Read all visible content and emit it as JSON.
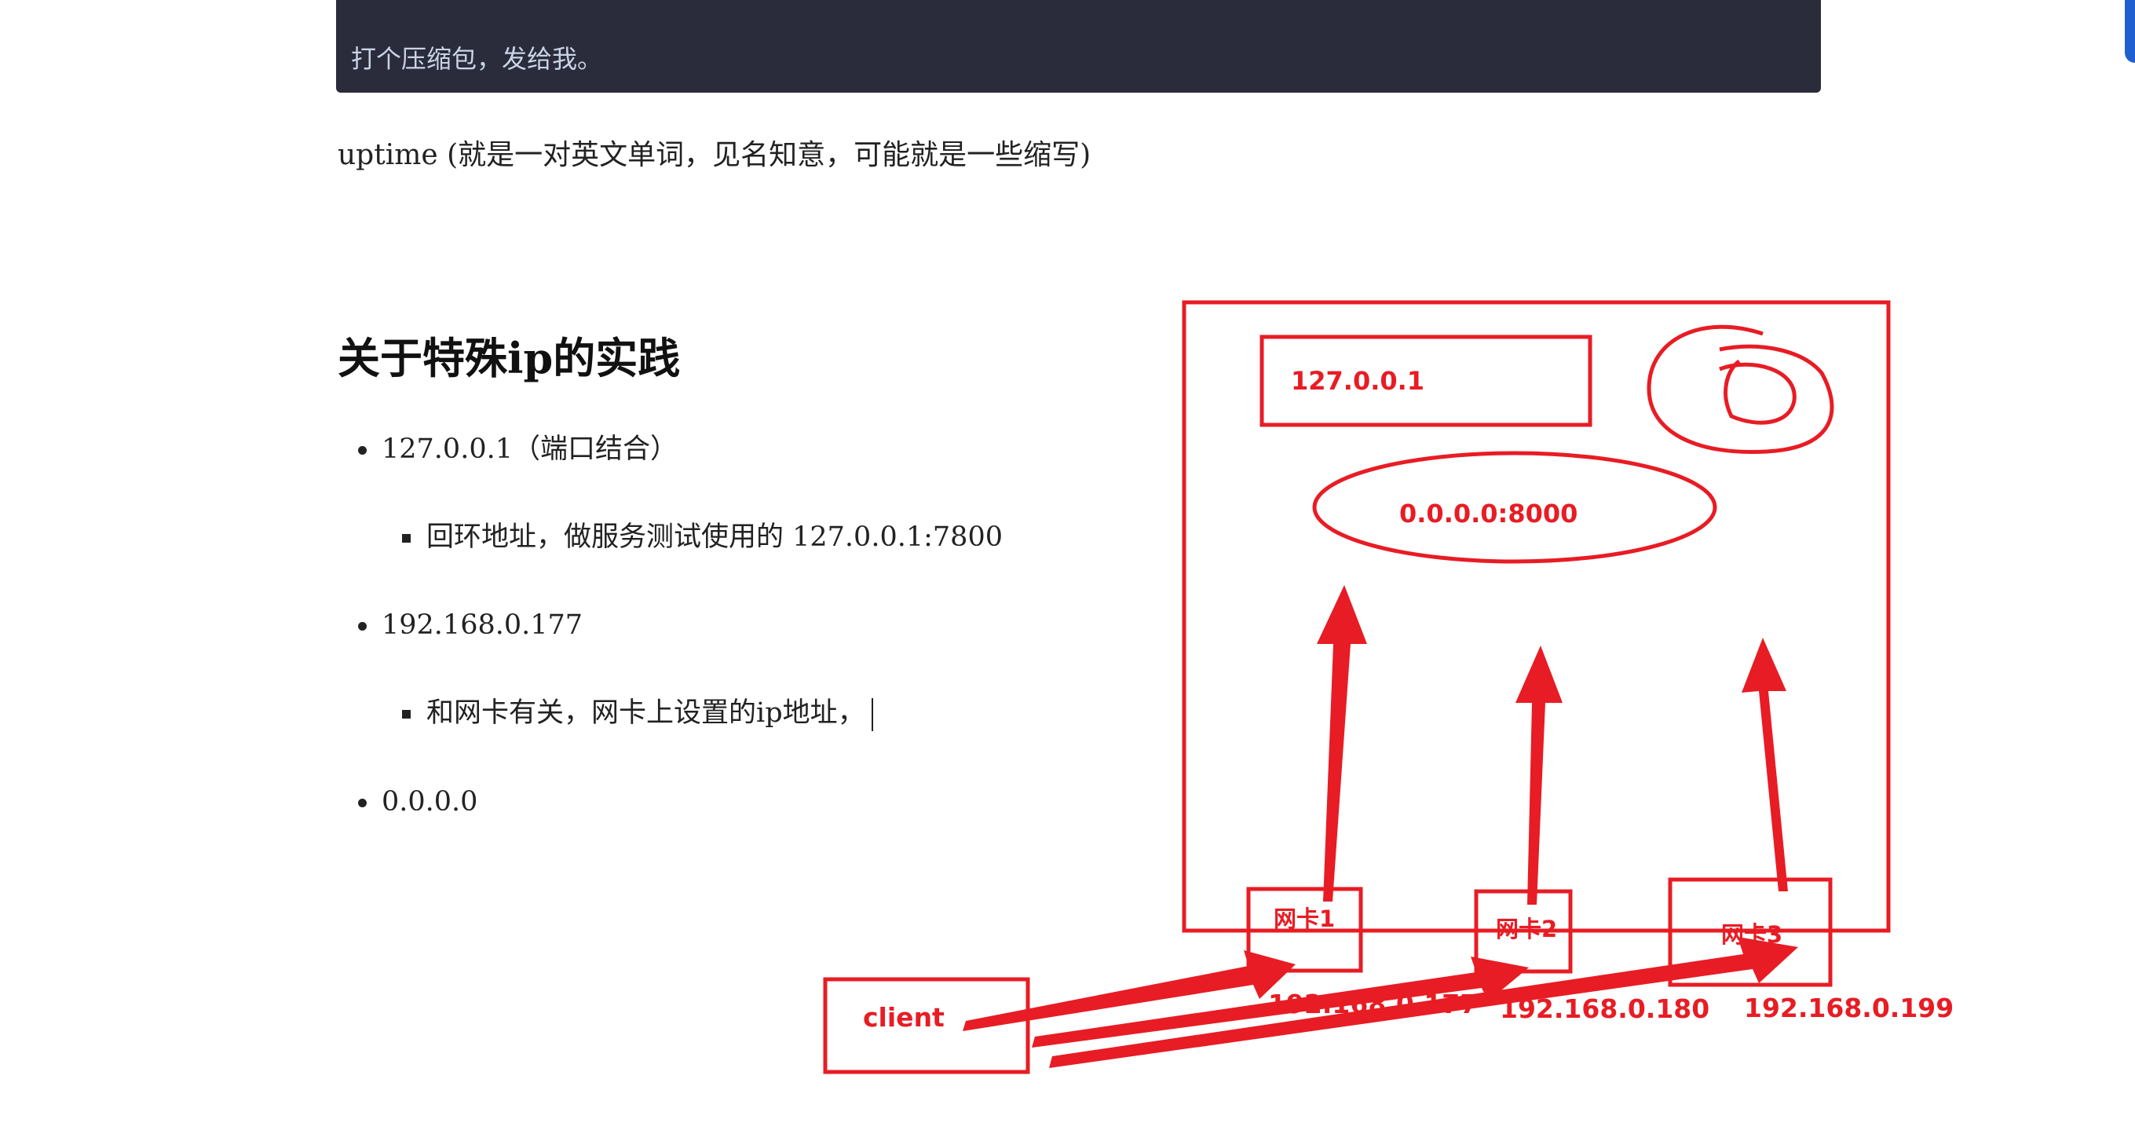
{
  "code_block": {
    "text": "打个压缩包，发给我。"
  },
  "paragraph": "uptime (就是一对英文单词，见名知意，可能就是一些缩写)",
  "heading": "关于特殊ip的实践",
  "list": [
    {
      "label": "127.0.0.1（端口结合）",
      "sub": "回环地址，做服务测试使用的 127.0.0.1:7800"
    },
    {
      "label": "192.168.0.177",
      "sub": "和网卡有关，网卡上设置的ip地址，"
    },
    {
      "label": "0.0.0.0"
    }
  ],
  "diagram": {
    "color": "#e81c24",
    "loopback_label": "127.0.0.1",
    "bind_label": "0.0.0.0:8000",
    "nics": [
      "网卡1",
      "网卡2",
      "网卡3"
    ],
    "nic_ips": [
      "192.168.0.177",
      "192.168.0.180",
      "192.168.0.199"
    ],
    "client_label": "client"
  }
}
